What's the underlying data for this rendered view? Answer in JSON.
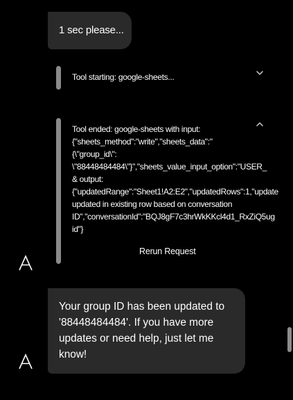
{
  "messages": {
    "top_bubble": "1 sec please...",
    "bottom_bubble_lines": [
      "Your group ID has been updated to",
      "'88448484484'. If you have more",
      "updates or need help, just let me",
      "know!"
    ]
  },
  "tool_start": {
    "label": "Tool starting: google-sheets..."
  },
  "tool_end": {
    "lines": [
      "Tool ended: google-sheets with input:",
      "{\"sheets_method\":\"write\",\"sheets_data\":\"",
      "{\\\"group_id\\\":",
      "\\\"88448484484\\\"}\",\"sheets_value_input_option\":\"USER_",
      "& output:",
      "{\"updatedRange\":\"Sheet1!A2:E2\",\"updatedRows\":1,\"update",
      "updated in existing row based on conversation",
      "ID\",\"conversationId\":\"BQJ8gF7c3hrWkKKcl4d1_RxZiQ5ug",
      "id\"}"
    ],
    "rerun_label": "Rerun Request"
  },
  "avatar_letter": "A",
  "icons": {
    "expand": "chevron-down-icon",
    "collapse": "chevron-up-icon",
    "avatar": "avatar-a-icon"
  },
  "colors": {
    "background": "#000000",
    "bubble": "#2a2a2a",
    "tool_bar": "#8a8a8a",
    "text": "#ffffff"
  }
}
